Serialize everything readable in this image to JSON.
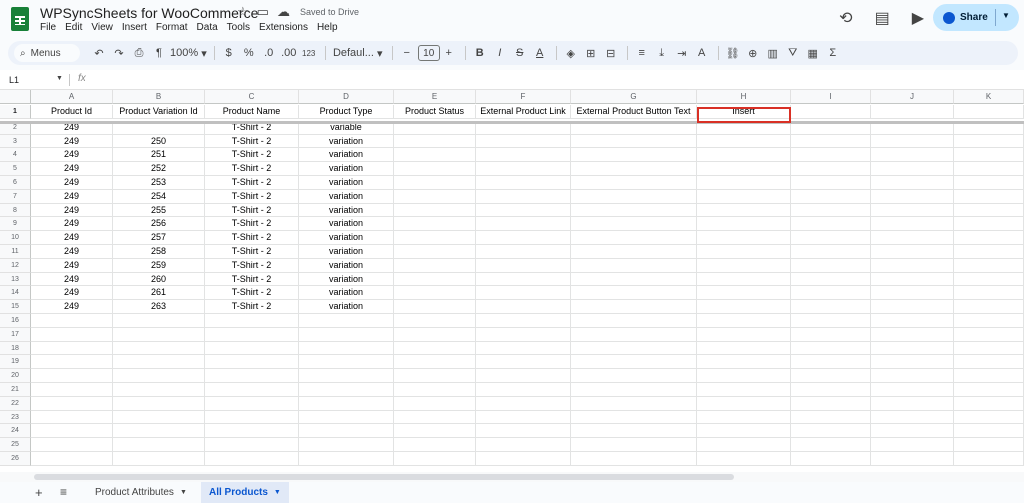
{
  "app": {
    "title": "WPSyncSheets for WooCommerce",
    "saved_status": "Saved to Drive",
    "share_label": "Share"
  },
  "menu": [
    "File",
    "Edit",
    "View",
    "Insert",
    "Format",
    "Data",
    "Tools",
    "Extensions",
    "Help"
  ],
  "toolbar": {
    "menus_label": "Menus",
    "zoom": "100%",
    "currency": "$",
    "percent": "%",
    "dec_decrease": ".0",
    "dec_increase": ".00",
    "number_format": "123",
    "font": "Defaul...",
    "font_size": "10"
  },
  "formula_bar": {
    "name_box": "L1",
    "fx": "fx"
  },
  "columns": [
    "A",
    "B",
    "C",
    "D",
    "E",
    "F",
    "G",
    "H",
    "I",
    "J",
    "K"
  ],
  "rows": [
    [
      "Product Id",
      "Product Variation Id",
      "Product Name",
      "Product Type",
      "Product Status",
      "External Product Link",
      "External Product Button Text",
      "Insert",
      "",
      "",
      ""
    ],
    [
      "249",
      "",
      "T-Shirt - 2",
      "variable",
      "",
      "",
      "",
      "",
      "",
      "",
      ""
    ],
    [
      "249",
      "250",
      "T-Shirt - 2",
      "variation",
      "",
      "",
      "",
      "",
      "",
      "",
      ""
    ],
    [
      "249",
      "251",
      "T-Shirt - 2",
      "variation",
      "",
      "",
      "",
      "",
      "",
      "",
      ""
    ],
    [
      "249",
      "252",
      "T-Shirt - 2",
      "variation",
      "",
      "",
      "",
      "",
      "",
      "",
      ""
    ],
    [
      "249",
      "253",
      "T-Shirt - 2",
      "variation",
      "",
      "",
      "",
      "",
      "",
      "",
      ""
    ],
    [
      "249",
      "254",
      "T-Shirt - 2",
      "variation",
      "",
      "",
      "",
      "",
      "",
      "",
      ""
    ],
    [
      "249",
      "255",
      "T-Shirt - 2",
      "variation",
      "",
      "",
      "",
      "",
      "",
      "",
      ""
    ],
    [
      "249",
      "256",
      "T-Shirt - 2",
      "variation",
      "",
      "",
      "",
      "",
      "",
      "",
      ""
    ],
    [
      "249",
      "257",
      "T-Shirt - 2",
      "variation",
      "",
      "",
      "",
      "",
      "",
      "",
      ""
    ],
    [
      "249",
      "258",
      "T-Shirt - 2",
      "variation",
      "",
      "",
      "",
      "",
      "",
      "",
      ""
    ],
    [
      "249",
      "259",
      "T-Shirt - 2",
      "variation",
      "",
      "",
      "",
      "",
      "",
      "",
      ""
    ],
    [
      "249",
      "260",
      "T-Shirt - 2",
      "variation",
      "",
      "",
      "",
      "",
      "",
      "",
      ""
    ],
    [
      "249",
      "261",
      "T-Shirt - 2",
      "variation",
      "",
      "",
      "",
      "",
      "",
      "",
      ""
    ],
    [
      "249",
      "263",
      "T-Shirt - 2",
      "variation",
      "",
      "",
      "",
      "",
      "",
      "",
      ""
    ],
    [
      "",
      "",
      "",
      "",
      "",
      "",
      "",
      "",
      "",
      "",
      ""
    ],
    [
      "",
      "",
      "",
      "",
      "",
      "",
      "",
      "",
      "",
      "",
      ""
    ],
    [
      "",
      "",
      "",
      "",
      "",
      "",
      "",
      "",
      "",
      "",
      ""
    ],
    [
      "",
      "",
      "",
      "",
      "",
      "",
      "",
      "",
      "",
      "",
      ""
    ],
    [
      "",
      "",
      "",
      "",
      "",
      "",
      "",
      "",
      "",
      "",
      ""
    ],
    [
      "",
      "",
      "",
      "",
      "",
      "",
      "",
      "",
      "",
      "",
      ""
    ],
    [
      "",
      "",
      "",
      "",
      "",
      "",
      "",
      "",
      "",
      "",
      ""
    ],
    [
      "",
      "",
      "",
      "",
      "",
      "",
      "",
      "",
      "",
      "",
      ""
    ],
    [
      "",
      "",
      "",
      "",
      "",
      "",
      "",
      "",
      "",
      "",
      ""
    ],
    [
      "",
      "",
      "",
      "",
      "",
      "",
      "",
      "",
      "",
      "",
      ""
    ],
    [
      "",
      "",
      "",
      "",
      "",
      "",
      "",
      "",
      "",
      "",
      ""
    ]
  ],
  "selected_cell": "H1",
  "sheets": [
    {
      "label": "Product Attributes",
      "active": false
    },
    {
      "label": "All Products",
      "active": true
    }
  ],
  "colors": {
    "selection_border": "#d93025",
    "share_bg": "#c2e7ff",
    "active_tab": "#0b57d0",
    "logo": "#188038"
  }
}
